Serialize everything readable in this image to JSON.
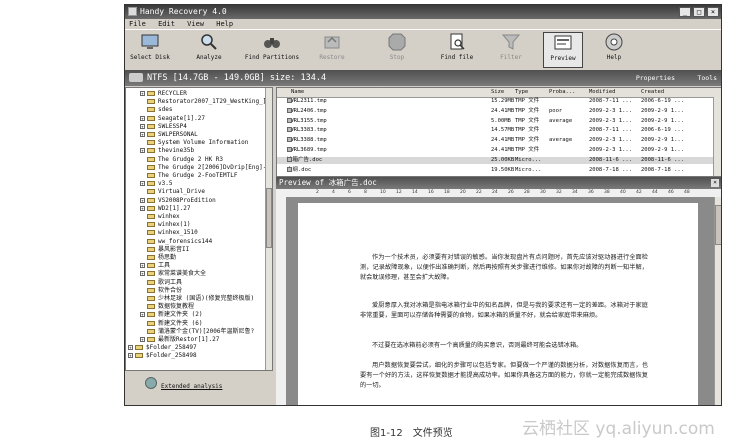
{
  "window": {
    "title": "Handy Recovery 4.0",
    "min": "_",
    "max": "□",
    "close": "×"
  },
  "menu": [
    "File",
    "Edit",
    "View",
    "Help"
  ],
  "toolbar": [
    {
      "label": "Select Disk",
      "icon": "monitor-icon",
      "enabled": true
    },
    {
      "label": "Analyze",
      "icon": "magnifier-icon",
      "enabled": true
    },
    {
      "label": "Find Partitions",
      "icon": "binoculars-icon",
      "enabled": true
    },
    {
      "label": "Restore",
      "icon": "restore-icon",
      "enabled": false
    },
    {
      "label": "Stop",
      "icon": "stop-icon",
      "enabled": false
    },
    {
      "label": "Find file",
      "icon": "find-file-icon",
      "enabled": true
    },
    {
      "label": "Filter",
      "icon": "filter-icon",
      "enabled": false
    },
    {
      "label": "Preview",
      "icon": "preview-icon",
      "enabled": true,
      "active": true
    },
    {
      "label": "Help",
      "icon": "help-icon",
      "enabled": true
    }
  ],
  "pathbar": {
    "text": "NTFS [14.7GB - 149.0GB] size: 134.4",
    "properties": "Properties",
    "tools": "Tools"
  },
  "tree": [
    {
      "label": "RECYCLER",
      "level": 1,
      "expand": "+"
    },
    {
      "label": "Restorator2007_1T29_WestKing_]",
      "level": 1,
      "expand": ""
    },
    {
      "label": "sdes",
      "level": 1,
      "expand": ""
    },
    {
      "label": "Seagate[1].27",
      "level": 1,
      "expand": "+"
    },
    {
      "label": "SWLESSP4",
      "level": 1,
      "expand": "+"
    },
    {
      "label": "SWLPERSONAL",
      "level": 1,
      "expand": "+"
    },
    {
      "label": "System Volume Information",
      "level": 1,
      "expand": ""
    },
    {
      "label": "thevine35b",
      "level": 1,
      "expand": "+"
    },
    {
      "label": "The Grudge 2 HK R3",
      "level": 1,
      "expand": ""
    },
    {
      "label": "The Grudge 2[2006]DvDrip[Eng]-",
      "level": 1,
      "expand": ""
    },
    {
      "label": "The Grudge 2-FooTEMTLF",
      "level": 1,
      "expand": ""
    },
    {
      "label": "v3.5",
      "level": 1,
      "expand": "+"
    },
    {
      "label": "Virtual_Drive",
      "level": 1,
      "expand": ""
    },
    {
      "label": "VS2008ProEdition",
      "level": 1,
      "expand": "+"
    },
    {
      "label": "WD2[1].27",
      "level": 1,
      "expand": "+"
    },
    {
      "label": "winhex",
      "level": 1,
      "expand": ""
    },
    {
      "label": "winhex(1)",
      "level": 1,
      "expand": ""
    },
    {
      "label": "winhex_1510",
      "level": 1,
      "expand": ""
    },
    {
      "label": "ww_forensics144",
      "level": 1,
      "expand": ""
    },
    {
      "label": "暴风影音II",
      "level": 1,
      "expand": ""
    },
    {
      "label": "杨思勤",
      "level": 1,
      "expand": ""
    },
    {
      "label": "工具",
      "level": 1,
      "expand": "+"
    },
    {
      "label": "家常菜谱美食大全",
      "level": 1,
      "expand": "+"
    },
    {
      "label": "歌词工具",
      "level": 1,
      "expand": ""
    },
    {
      "label": "软件合份",
      "level": 1,
      "expand": ""
    },
    {
      "label": "少林足球 (国语)(修复完整终极版)",
      "level": 1,
      "expand": ""
    },
    {
      "label": "数据恢复教程",
      "level": 1,
      "expand": ""
    },
    {
      "label": "新建文件夹 (2)",
      "level": 1,
      "expand": "+"
    },
    {
      "label": "新建文件夹 (6)",
      "level": 1,
      "expand": ""
    },
    {
      "label": "蒲洛蒙个金(TV)[2006年温斯尼鲁?",
      "level": 1,
      "expand": ""
    },
    {
      "label": "最新版Restor[1].27",
      "level": 1,
      "expand": "+"
    },
    {
      "label": "$Folder_258497",
      "level": 0,
      "expand": "+"
    },
    {
      "label": "$Folder_258498",
      "level": 0,
      "expand": "+"
    }
  ],
  "extended": {
    "label": "Extended analysis"
  },
  "filelist": {
    "columns": [
      "Name",
      "Size",
      "Type",
      "Proba...",
      "Modified",
      "Created"
    ],
    "rows": [
      {
        "name": "~WRL2311.tmp",
        "size": "15.29MB",
        "type": "TMP 文件",
        "prob": "",
        "modified": "2008-7-11 ...",
        "created": "2006-6-19 ...",
        "selected": false
      },
      {
        "name": "~WRL2406.tmp",
        "size": "24.41MB",
        "type": "TMP 文件",
        "prob": "poor",
        "modified": "2009-2-3 1...",
        "created": "2009-2-9 1...",
        "selected": false
      },
      {
        "name": "~WRL3155.tmp",
        "size": "5.00MB",
        "type": "TMP 文件",
        "prob": "average",
        "modified": "2009-2-3 1...",
        "created": "2009-2-9 1...",
        "selected": false
      },
      {
        "name": "~WRL3383.tmp",
        "size": "14.57MB",
        "type": "TMP 文件",
        "prob": "",
        "modified": "2008-7-11 ...",
        "created": "2006-6-19 ...",
        "selected": false
      },
      {
        "name": "~WRL3388.tmp",
        "size": "24.41MB",
        "type": "TMP 文件",
        "prob": "average",
        "modified": "2009-2-3 1...",
        "created": "2009-2-9 1...",
        "selected": false
      },
      {
        "name": "~WRL3689.tmp",
        "size": "24.41MB",
        "type": "TMP 文件",
        "prob": "",
        "modified": "2009-2-3 1...",
        "created": "2009-2-9 1...",
        "selected": false
      },
      {
        "name": "冰箱广告.doc",
        "size": "25.00KB",
        "type": "Micro...",
        "prob": "",
        "modified": "2008-11-6 ...",
        "created": "2008-11-6 ...",
        "selected": true
      },
      {
        "name": "大纲.doc",
        "size": "19.50KB",
        "type": "Micro...",
        "prob": "",
        "modified": "2008-7-18 ...",
        "created": "2008-7-18 ...",
        "selected": false
      }
    ]
  },
  "preview": {
    "title": "Preview of 冰箱广告.doc",
    "close": "×",
    "ruler": [
      "2",
      "4",
      "6",
      "8",
      "10",
      "12",
      "14",
      "16",
      "18",
      "20",
      "22",
      "24",
      "26",
      "28",
      "30",
      "32",
      "34",
      "36",
      "38",
      "40",
      "42",
      "44",
      "46",
      "48"
    ],
    "paragraphs": [
      "作为一个技术员，必须要有对错误的敏感。当你发现盘片有点问题时，首先应该对驱动器进行全面检测，记录故障现象，以便作出准确判断，然后再按照有关步骤进行维修。如果你对故障的判断一知半解，就会耽误修理，甚至会扩大故障。",
      "爱厨意厚入我对冰箱是指电冰箱行业中的知名品牌，但是与我的要求还有一定的差距。冰箱对于家庭非常重要，里面可以存储各种需要的食物，如果冰箱的质量不好，就会给家庭带来麻烦。",
      "不过要在选冰箱前必须有一个高质量的购买意识，否则最终可能会选错冰箱。",
      "用户数据恢复要尝试，细化的步骤可以包括专家。但要做一个严谨的数据分析，对数据恢复而言，也要有一个好的方法，这样恢复数据才能提高成功率。如果你具备这方面的能力，你就一定能完成数据恢复的一切。"
    ]
  },
  "caption": "图1-12　文件预览",
  "watermark": "云栖社区 yq.aliyun.com"
}
